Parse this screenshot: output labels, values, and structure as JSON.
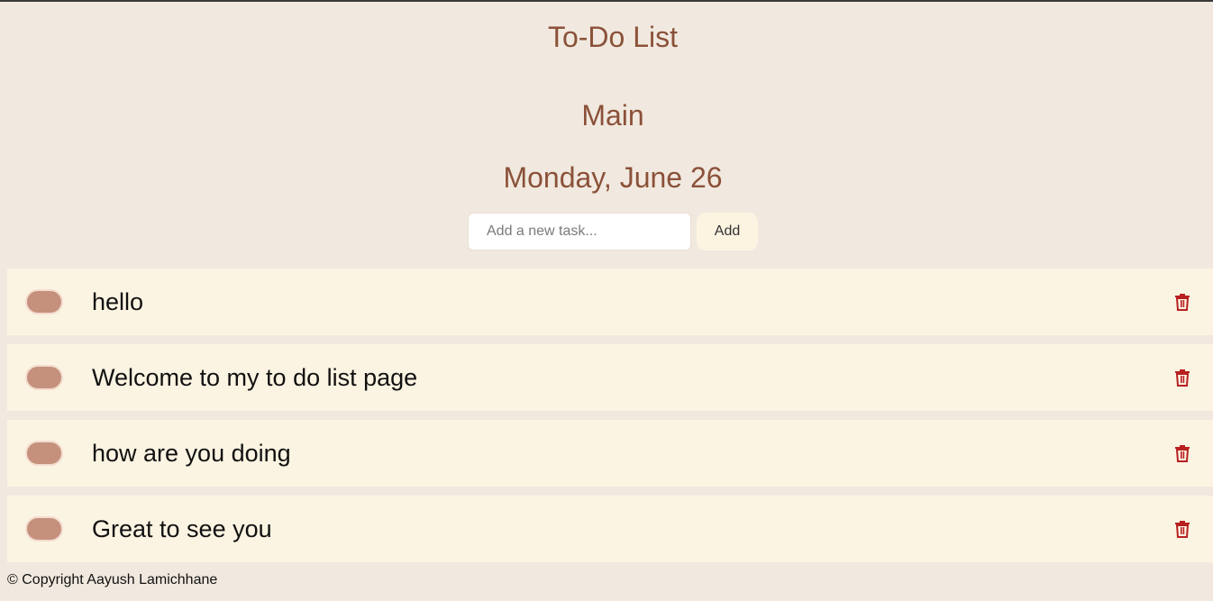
{
  "header": {
    "title": "To-Do List",
    "list_name": "Main",
    "date": "Monday, June 26"
  },
  "new_task": {
    "placeholder": "Add a new task...",
    "value": "",
    "add_label": "Add"
  },
  "tasks": [
    {
      "text": "hello",
      "completed": false
    },
    {
      "text": "Welcome to my to do list page",
      "completed": false
    },
    {
      "text": "how are you doing",
      "completed": false
    },
    {
      "text": "Great to see you",
      "completed": false
    }
  ],
  "footer": {
    "copyright": "© Copyright Aayush Lamichhane"
  },
  "colors": {
    "background": "#f1e9df",
    "heading": "#8b5139",
    "task_row": "#fcf4e2",
    "toggle": "#c5917c",
    "delete_icon": "#b81f1f"
  },
  "icons": {
    "delete": "trash-icon"
  }
}
